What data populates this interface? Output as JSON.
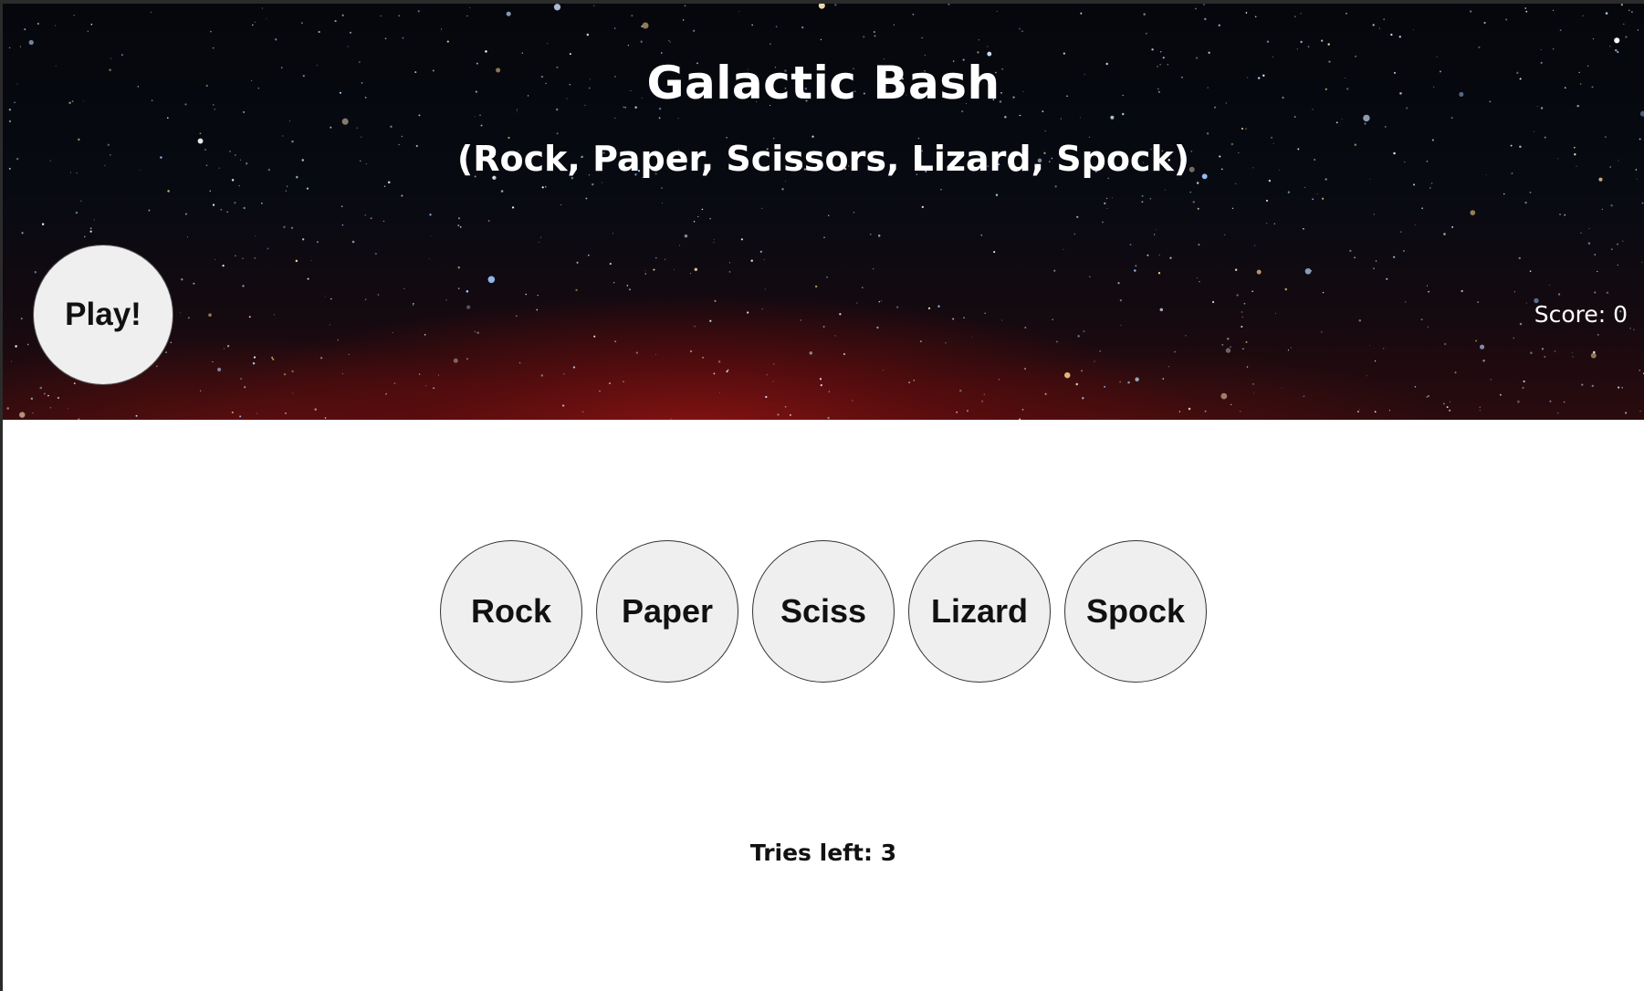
{
  "header": {
    "title": "Galactic Bash",
    "subtitle": "(Rock, Paper, Scissors, Lizard, Spock)",
    "play_label": "Play!",
    "score_label": "Score: 0"
  },
  "choices": [
    {
      "label": "Rock"
    },
    {
      "label": "Paper"
    },
    {
      "label": "Sciss"
    },
    {
      "label": "Lizard"
    },
    {
      "label": "Spock"
    }
  ],
  "status": {
    "tries_label": "Tries left: 3"
  },
  "colors": {
    "button_bg": "#efefef",
    "header_text": "#ffffff",
    "page_bg": "#ffffff"
  }
}
